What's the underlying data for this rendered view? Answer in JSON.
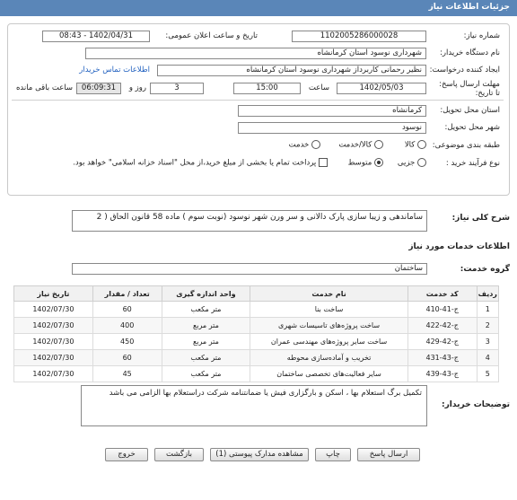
{
  "page": {
    "title": "جزئیات اطلاعات نیاز"
  },
  "form": {
    "need_number": {
      "label": "شماره نیاز:",
      "value": "1102005286000028"
    },
    "announce_date": {
      "label": "تاریخ و ساعت اعلان عمومی:",
      "value": "1402/04/31 - 08:43"
    },
    "buyer_org": {
      "label": "نام دستگاه خریدار:",
      "value": "شهرداری نوسود استان کرمانشاه"
    },
    "requester": {
      "label": "ایجاد کننده درخواست:",
      "value": "نظیر رحمانی کاربرداز شهرداری نوسود استان کرمانشاه",
      "contact_link": "اطلاعات تماس خریدار"
    },
    "deadline": {
      "label": "مهلت ارسال پاسخ: تا تاریخ:",
      "date": "1402/05/03",
      "time_label": "ساعت",
      "time": "15:00",
      "days": "3",
      "days_label": "روز و",
      "remaining": "06:09:31",
      "remaining_label": "ساعت باقی مانده"
    },
    "delivery_province": {
      "label": "استان محل تحویل:",
      "value": "کرمانشاه"
    },
    "delivery_city": {
      "label": "شهر محل تحویل:",
      "value": "نوسود"
    },
    "category": {
      "label": "طبقه بندی موضوعی:",
      "options": [
        "کالا",
        "کالا/خدمت",
        "خدمت"
      ],
      "selected": "خدمت"
    },
    "process_type": {
      "label": "نوع فرآیند خرید :",
      "options": [
        "جزیی",
        "متوسط"
      ],
      "selected": "متوسط",
      "payment_note": "پرداخت تمام یا بخشی از مبلغ خرید،از محل \"اسناد خزانه اسلامی\" خواهد بود."
    }
  },
  "general_description": {
    "label": "شرح کلی نیاز:",
    "value": "ساماندهی و زیبا سازی پارک دالانی و سر ورن شهر نوسود (نوبت سوم ) ماده 58 قانون الحاق ( 2"
  },
  "services_title": "اطلاعات خدمات مورد نیاز",
  "service_group": {
    "label": "گروه خدمت:",
    "value": "ساختمان"
  },
  "table": {
    "headers": [
      "ردیف",
      "کد خدمت",
      "نام خدمت",
      "واحد اندازه گیری",
      "تعداد / مقدار",
      "تاریخ نیاز"
    ],
    "rows": [
      [
        "1",
        "ج-41-410",
        "ساخت بنا",
        "متر مکعب",
        "60",
        "1402/07/30"
      ],
      [
        "2",
        "ج-42-422",
        "ساخت پروژه‌های تاسیسات شهری",
        "متر مربع",
        "400",
        "1402/07/30"
      ],
      [
        "3",
        "ج-42-429",
        "ساخت سایر پروژه‌های مهندسی عمران",
        "متر مربع",
        "450",
        "1402/07/30"
      ],
      [
        "4",
        "ج-43-431",
        "تخریب و آماده‌سازی محوطه",
        "متر مکعب",
        "60",
        "1402/07/30"
      ],
      [
        "5",
        "ج-43-439",
        "سایر فعالیت‌های تخصصی ساختمان",
        "متر مکعب",
        "45",
        "1402/07/30"
      ]
    ]
  },
  "buyer_notes": {
    "label": "توضیحات خریدار:",
    "value": "تکمیل برگ استعلام بها ، اسکن و بارگزاری فیش یا ضمانتنامه شرکت دراستعلام بها الزامی می باشد"
  },
  "buttons": {
    "send_reply": "ارسال پاسخ",
    "print": "چاپ",
    "attachments": "مشاهده مدارک پیوستی (1)",
    "back": "بازگشت",
    "exit": "خروج"
  }
}
